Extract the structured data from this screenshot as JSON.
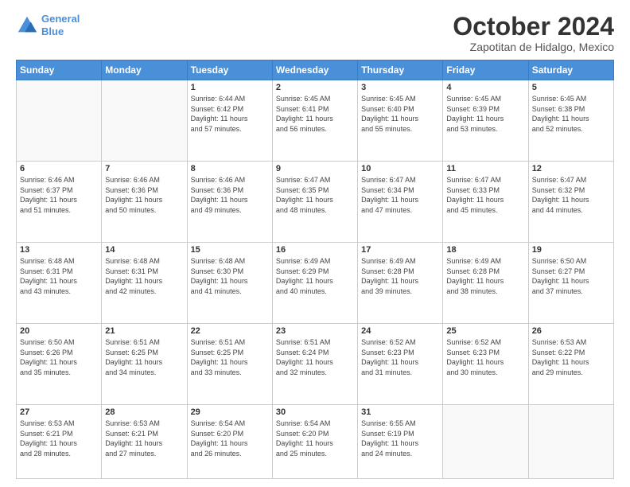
{
  "logo": {
    "line1": "General",
    "line2": "Blue"
  },
  "header": {
    "month": "October 2024",
    "location": "Zapotitan de Hidalgo, Mexico"
  },
  "weekdays": [
    "Sunday",
    "Monday",
    "Tuesday",
    "Wednesday",
    "Thursday",
    "Friday",
    "Saturday"
  ],
  "weeks": [
    [
      {
        "day": "",
        "info": ""
      },
      {
        "day": "",
        "info": ""
      },
      {
        "day": "1",
        "info": "Sunrise: 6:44 AM\nSunset: 6:42 PM\nDaylight: 11 hours\nand 57 minutes."
      },
      {
        "day": "2",
        "info": "Sunrise: 6:45 AM\nSunset: 6:41 PM\nDaylight: 11 hours\nand 56 minutes."
      },
      {
        "day": "3",
        "info": "Sunrise: 6:45 AM\nSunset: 6:40 PM\nDaylight: 11 hours\nand 55 minutes."
      },
      {
        "day": "4",
        "info": "Sunrise: 6:45 AM\nSunset: 6:39 PM\nDaylight: 11 hours\nand 53 minutes."
      },
      {
        "day": "5",
        "info": "Sunrise: 6:45 AM\nSunset: 6:38 PM\nDaylight: 11 hours\nand 52 minutes."
      }
    ],
    [
      {
        "day": "6",
        "info": "Sunrise: 6:46 AM\nSunset: 6:37 PM\nDaylight: 11 hours\nand 51 minutes."
      },
      {
        "day": "7",
        "info": "Sunrise: 6:46 AM\nSunset: 6:36 PM\nDaylight: 11 hours\nand 50 minutes."
      },
      {
        "day": "8",
        "info": "Sunrise: 6:46 AM\nSunset: 6:36 PM\nDaylight: 11 hours\nand 49 minutes."
      },
      {
        "day": "9",
        "info": "Sunrise: 6:47 AM\nSunset: 6:35 PM\nDaylight: 11 hours\nand 48 minutes."
      },
      {
        "day": "10",
        "info": "Sunrise: 6:47 AM\nSunset: 6:34 PM\nDaylight: 11 hours\nand 47 minutes."
      },
      {
        "day": "11",
        "info": "Sunrise: 6:47 AM\nSunset: 6:33 PM\nDaylight: 11 hours\nand 45 minutes."
      },
      {
        "day": "12",
        "info": "Sunrise: 6:47 AM\nSunset: 6:32 PM\nDaylight: 11 hours\nand 44 minutes."
      }
    ],
    [
      {
        "day": "13",
        "info": "Sunrise: 6:48 AM\nSunset: 6:31 PM\nDaylight: 11 hours\nand 43 minutes."
      },
      {
        "day": "14",
        "info": "Sunrise: 6:48 AM\nSunset: 6:31 PM\nDaylight: 11 hours\nand 42 minutes."
      },
      {
        "day": "15",
        "info": "Sunrise: 6:48 AM\nSunset: 6:30 PM\nDaylight: 11 hours\nand 41 minutes."
      },
      {
        "day": "16",
        "info": "Sunrise: 6:49 AM\nSunset: 6:29 PM\nDaylight: 11 hours\nand 40 minutes."
      },
      {
        "day": "17",
        "info": "Sunrise: 6:49 AM\nSunset: 6:28 PM\nDaylight: 11 hours\nand 39 minutes."
      },
      {
        "day": "18",
        "info": "Sunrise: 6:49 AM\nSunset: 6:28 PM\nDaylight: 11 hours\nand 38 minutes."
      },
      {
        "day": "19",
        "info": "Sunrise: 6:50 AM\nSunset: 6:27 PM\nDaylight: 11 hours\nand 37 minutes."
      }
    ],
    [
      {
        "day": "20",
        "info": "Sunrise: 6:50 AM\nSunset: 6:26 PM\nDaylight: 11 hours\nand 35 minutes."
      },
      {
        "day": "21",
        "info": "Sunrise: 6:51 AM\nSunset: 6:25 PM\nDaylight: 11 hours\nand 34 minutes."
      },
      {
        "day": "22",
        "info": "Sunrise: 6:51 AM\nSunset: 6:25 PM\nDaylight: 11 hours\nand 33 minutes."
      },
      {
        "day": "23",
        "info": "Sunrise: 6:51 AM\nSunset: 6:24 PM\nDaylight: 11 hours\nand 32 minutes."
      },
      {
        "day": "24",
        "info": "Sunrise: 6:52 AM\nSunset: 6:23 PM\nDaylight: 11 hours\nand 31 minutes."
      },
      {
        "day": "25",
        "info": "Sunrise: 6:52 AM\nSunset: 6:23 PM\nDaylight: 11 hours\nand 30 minutes."
      },
      {
        "day": "26",
        "info": "Sunrise: 6:53 AM\nSunset: 6:22 PM\nDaylight: 11 hours\nand 29 minutes."
      }
    ],
    [
      {
        "day": "27",
        "info": "Sunrise: 6:53 AM\nSunset: 6:21 PM\nDaylight: 11 hours\nand 28 minutes."
      },
      {
        "day": "28",
        "info": "Sunrise: 6:53 AM\nSunset: 6:21 PM\nDaylight: 11 hours\nand 27 minutes."
      },
      {
        "day": "29",
        "info": "Sunrise: 6:54 AM\nSunset: 6:20 PM\nDaylight: 11 hours\nand 26 minutes."
      },
      {
        "day": "30",
        "info": "Sunrise: 6:54 AM\nSunset: 6:20 PM\nDaylight: 11 hours\nand 25 minutes."
      },
      {
        "day": "31",
        "info": "Sunrise: 6:55 AM\nSunset: 6:19 PM\nDaylight: 11 hours\nand 24 minutes."
      },
      {
        "day": "",
        "info": ""
      },
      {
        "day": "",
        "info": ""
      }
    ]
  ]
}
